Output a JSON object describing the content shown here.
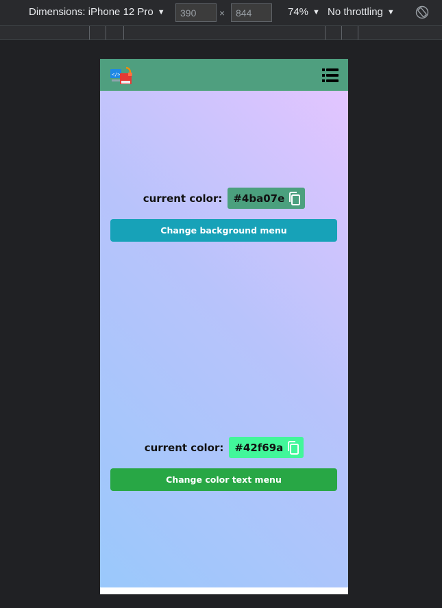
{
  "devtools": {
    "device_label": "Dimensions: iPhone 12 Pro",
    "width_value": "390",
    "height_value": "844",
    "times": "×",
    "zoom": "74%",
    "throttle": "No throttling",
    "caret": "▼"
  },
  "app": {
    "header_color": "#4f9f7f",
    "sections": [
      {
        "label": "current color:",
        "color_value": "#4ba07e",
        "color_hex": "#4ba07e",
        "button_label": "Change background menu",
        "button_color": "#17a2b8"
      },
      {
        "label": "current color:",
        "color_value": "#42f69a",
        "color_hex": "#42f69a",
        "button_label": "Change color text menu",
        "button_color": "#28a745"
      }
    ]
  }
}
